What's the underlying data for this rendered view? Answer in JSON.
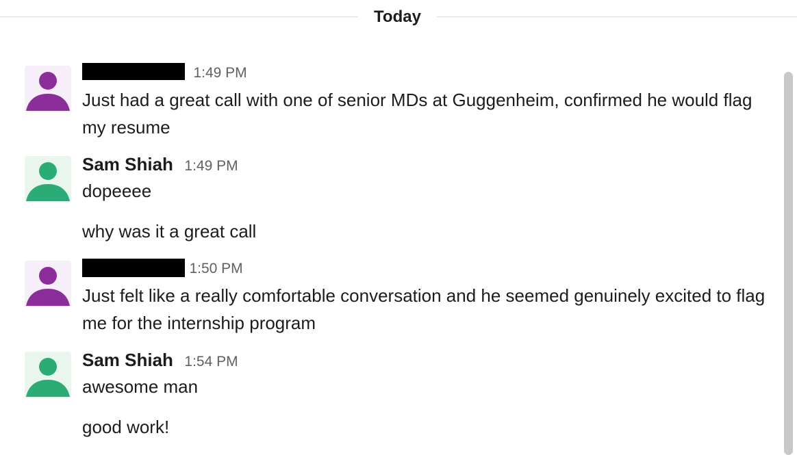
{
  "divider": {
    "label": "Today"
  },
  "messages": [
    {
      "sender": "",
      "sender_redacted": true,
      "time": "1:49 PM",
      "avatar_color": "#8b2d9a",
      "lines": [
        "Just had a great call with one of senior MDs at Guggenheim, confirmed he would flag my resume"
      ]
    },
    {
      "sender": "Sam Shiah",
      "sender_redacted": false,
      "time": "1:49 PM",
      "avatar_color": "#2bac76",
      "lines": [
        "dopeeee",
        "why was it a great call"
      ]
    },
    {
      "sender": "",
      "sender_redacted": true,
      "time": "1:50 PM",
      "avatar_color": "#8b2d9a",
      "lines": [
        "Just felt like a really comfortable conversation and he seemed genuinely excited to flag me for the internship program"
      ]
    },
    {
      "sender": "Sam Shiah",
      "sender_redacted": false,
      "time": "1:54 PM",
      "avatar_color": "#2bac76",
      "lines": [
        "awesome man",
        "good work!"
      ]
    }
  ]
}
